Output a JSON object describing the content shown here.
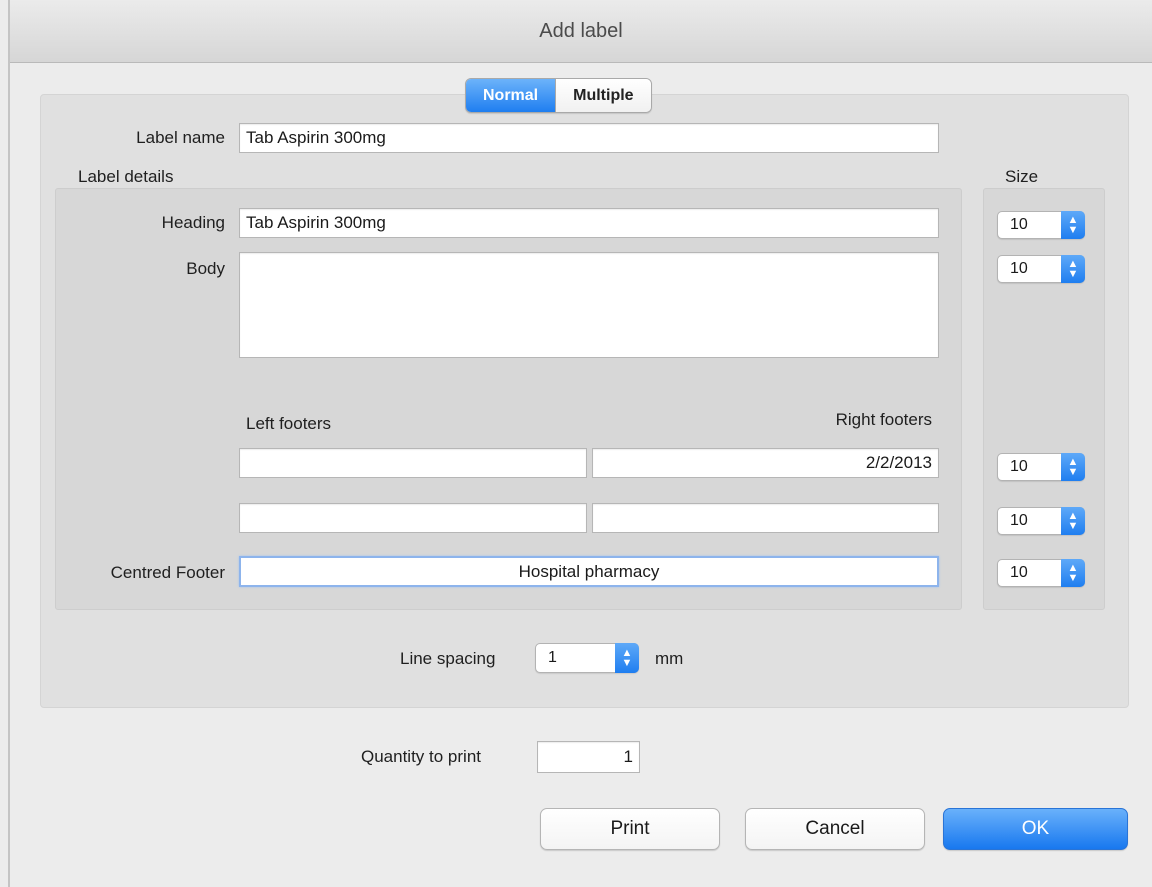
{
  "window": {
    "title": "Add label"
  },
  "tabs": [
    {
      "label": "Normal",
      "active": true
    },
    {
      "label": "Multiple",
      "active": false
    }
  ],
  "form": {
    "label_name_label": "Label name",
    "label_name_value": "Tab Aspirin 300mg",
    "label_details_label": "Label details",
    "size_label": "Size",
    "heading_label": "Heading",
    "heading_value": "Tab Aspirin 300mg",
    "body_label": "Body",
    "body_value": "",
    "left_footers_label": "Left footers",
    "right_footers_label": "Right footers",
    "left_footer_1": "",
    "right_footer_1": "2/2/2013",
    "left_footer_2": "",
    "right_footer_2": "",
    "centred_footer_label": "Centred Footer",
    "centred_footer_value": "Hospital pharmacy",
    "sizes": {
      "heading": "10",
      "body": "10",
      "footer1": "10",
      "footer2": "10",
      "centred": "10"
    },
    "line_spacing_label": "Line spacing",
    "line_spacing_value": "1",
    "line_spacing_unit": "mm",
    "quantity_label": "Quantity to print",
    "quantity_value": "1"
  },
  "buttons": {
    "print": "Print",
    "cancel": "Cancel",
    "ok": "OK"
  },
  "colors": {
    "accent": "#1f7ef0",
    "panel": "#e0e0e0",
    "background": "#ececec"
  }
}
